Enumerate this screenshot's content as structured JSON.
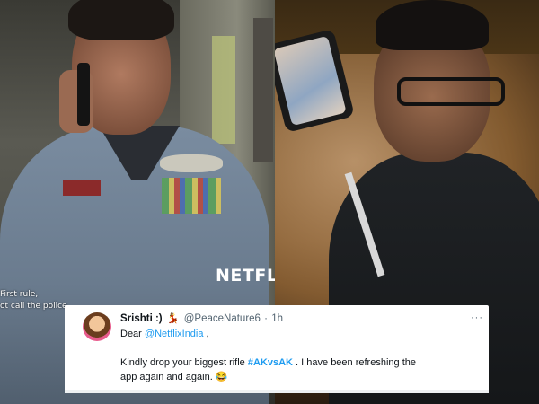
{
  "stills": {
    "left": {
      "watermark": "NETFLIX",
      "subtitle_line1": "First rule,",
      "subtitle_line2": "ot call the police."
    }
  },
  "tweet": {
    "display_name": "Srishti :)",
    "name_emoji": "💃",
    "handle": "@PeaceNature6",
    "separator": "·",
    "time": "1h",
    "more": "···",
    "greeting_prefix": "Dear ",
    "mention": "@NetflixIndia",
    "greeting_suffix": " ,",
    "body_part1": "Kindly drop your biggest rifle ",
    "hashtag": "#AKvsAK",
    "body_part2": " . I have been refreshing the",
    "body_line2": "app again and again. ",
    "laugh_emoji": "😂"
  },
  "colors": {
    "link": "#1d9bf0",
    "text": "#0f1419",
    "muted": "#536471"
  }
}
